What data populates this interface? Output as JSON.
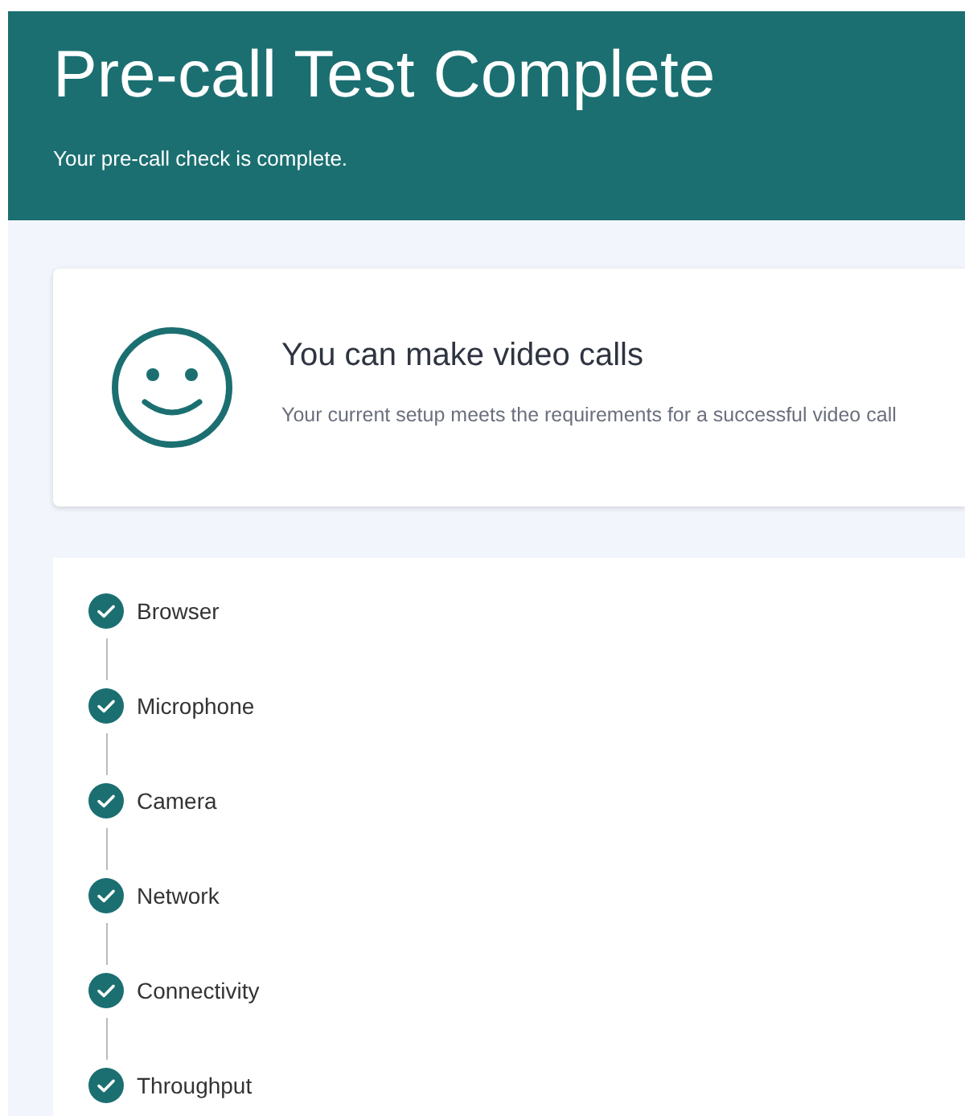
{
  "header": {
    "title": "Pre-call Test Complete",
    "subtitle": "Your pre-call check is complete."
  },
  "result": {
    "title": "You can make video calls",
    "message": "Your current setup meets the requirements for a successful video call"
  },
  "steps": [
    {
      "label": "Browser",
      "checked": true
    },
    {
      "label": "Microphone",
      "checked": true
    },
    {
      "label": "Camera",
      "checked": true
    },
    {
      "label": "Network",
      "checked": true
    },
    {
      "label": "Connectivity",
      "checked": true
    },
    {
      "label": "Throughput",
      "checked": true
    }
  ]
}
